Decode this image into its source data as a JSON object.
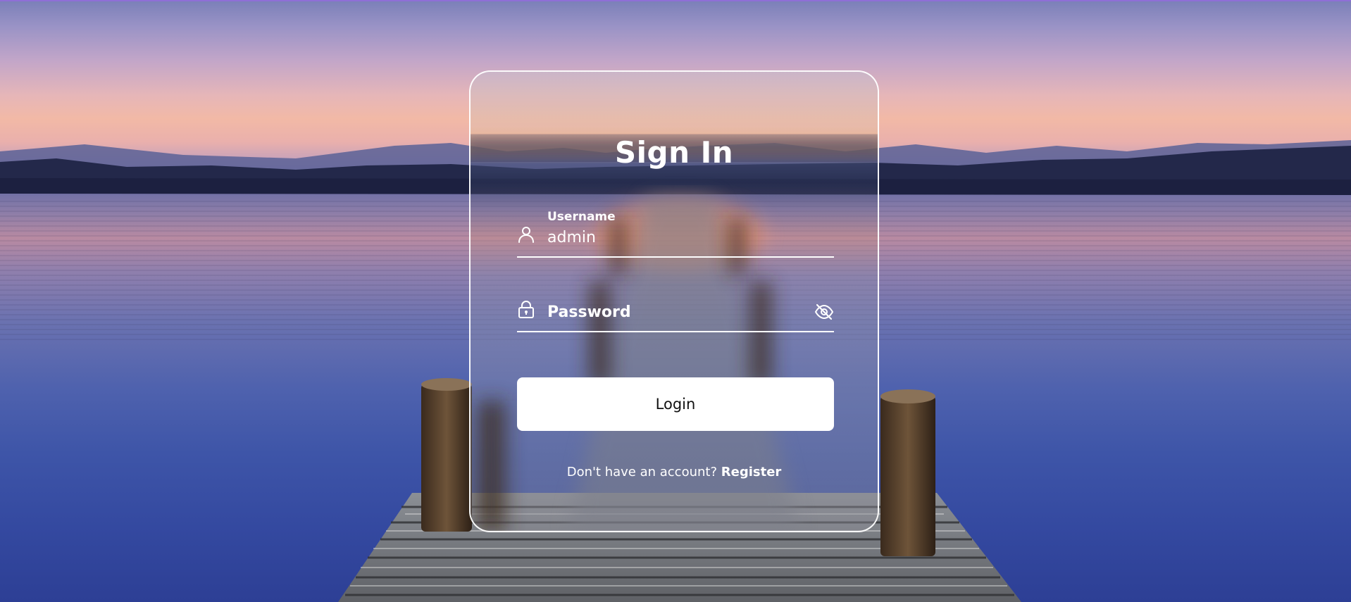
{
  "page": {
    "colors": {
      "card_border": "#ffffff",
      "button_bg": "#ffffff",
      "button_text": "#111111",
      "text": "#ffffff",
      "top_strip": "#8f6fd6"
    }
  },
  "signin": {
    "title": "Sign In",
    "username": {
      "label": "Username",
      "value": "admin",
      "icon": "user-icon"
    },
    "password": {
      "placeholder": "Password",
      "value": "",
      "icon": "lock-icon",
      "toggle_icon": "eye-slash-icon"
    },
    "login_label": "Login",
    "register_prompt": "Don't have an account?",
    "register_link": "Register"
  }
}
